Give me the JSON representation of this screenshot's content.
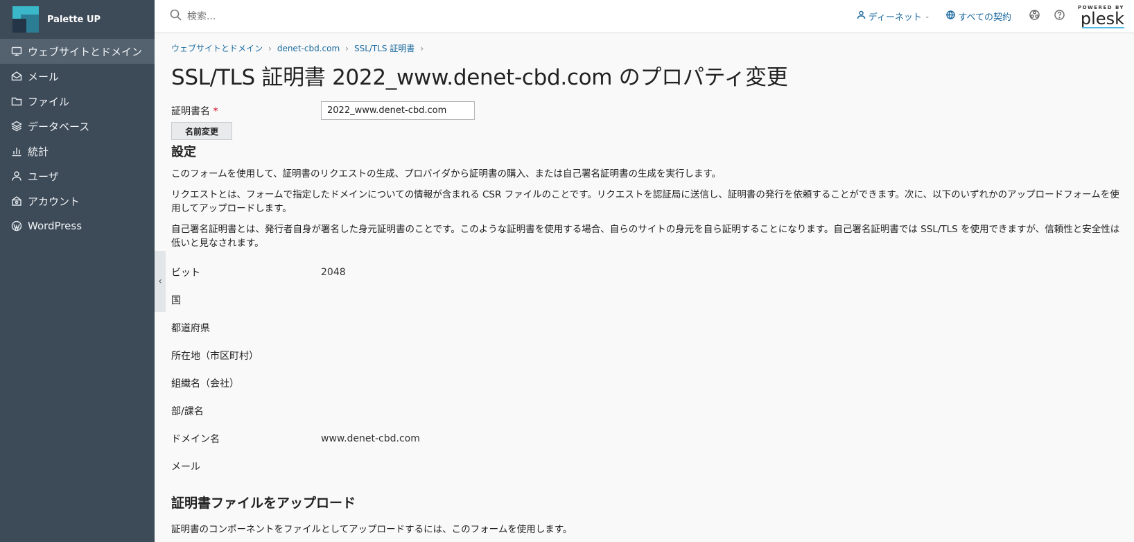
{
  "brand": {
    "name": "Palette UP"
  },
  "sidebar": {
    "items": [
      {
        "label": "ウェブサイトとドメイン",
        "icon": "monitor-icon",
        "active": true
      },
      {
        "label": "メール",
        "icon": "mail-icon"
      },
      {
        "label": "ファイル",
        "icon": "folder-icon"
      },
      {
        "label": "データベース",
        "icon": "database-icon"
      },
      {
        "label": "統計",
        "icon": "bar-chart-icon"
      },
      {
        "label": "ユーザ",
        "icon": "user-icon"
      },
      {
        "label": "アカウント",
        "icon": "account-icon"
      },
      {
        "label": "WordPress",
        "icon": "wordpress-icon"
      }
    ]
  },
  "topbar": {
    "search_placeholder": "検索...",
    "user_label": "ディーネット",
    "subscriptions_label": "すべての契約",
    "plesk_powered": "POWERED BY",
    "plesk_name": "plesk"
  },
  "breadcrumb": [
    "ウェブサイトとドメイン",
    "denet-cbd.com",
    "SSL/TLS 証明書"
  ],
  "page": {
    "title": "SSL/TLS 証明書 2022_www.denet-cbd.com のプロパティ変更",
    "cert_name_label": "証明書名",
    "required_mark": "*",
    "cert_name_value": "2022_www.denet-cbd.com",
    "rename_button": "名前変更",
    "settings_heading": "設定",
    "desc1": "このフォームを使用して、証明書のリクエストの生成、プロバイダから証明書の購入、または自己署名証明書の生成を実行します。",
    "desc2": "リクエストとは、フォームで指定したドメインについての情報が含まれる CSR ファイルのことです。リクエストを認証局に送信し、証明書の発行を依頼することができます。次に、以下のいずれかのアップロードフォームを使用してアップロードします。",
    "desc3": "自己署名証明書とは、発行者自身が署名した身元証明書のことです。このような証明書を使用する場合、自らのサイトの身元を自ら証明することになります。自己署名証明書では SSL/TLS を使用できますが、信頼性と安全性は低いと見なされます。",
    "fields": [
      {
        "label": "ビット",
        "value": "2048"
      },
      {
        "label": "国",
        "value": ""
      },
      {
        "label": "都道府県",
        "value": ""
      },
      {
        "label": "所在地（市区町村）",
        "value": ""
      },
      {
        "label": "組織名（会社）",
        "value": ""
      },
      {
        "label": "部/課名",
        "value": ""
      },
      {
        "label": "ドメイン名",
        "value": "www.denet-cbd.com"
      },
      {
        "label": "メール",
        "value": ""
      }
    ],
    "upload_heading": "証明書ファイルをアップロード",
    "upload_desc": "証明書のコンポーネントをファイルとしてアップロードするには、このフォームを使用します。"
  }
}
